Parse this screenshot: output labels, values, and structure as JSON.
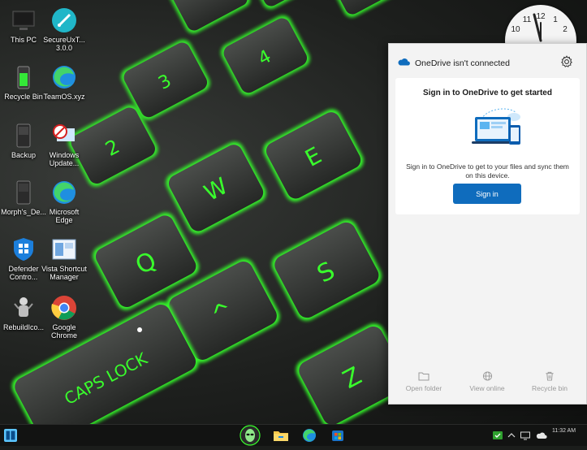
{
  "desktop": {
    "icons": [
      {
        "label": "This PC",
        "icon": "this-pc-icon"
      },
      {
        "label": "SecureUxT...\n3.0.0",
        "icon": "secureux-icon"
      },
      {
        "label": "Recycle Bin",
        "icon": "recycle-bin-icon"
      },
      {
        "label": "TeamOS.xyz",
        "icon": "edge-icon"
      },
      {
        "label": "Backup",
        "icon": "backup-icon"
      },
      {
        "label": "Windows\nUpdate...",
        "icon": "windows-update-icon"
      },
      {
        "label": "Morph's_De...",
        "icon": "morph-icon"
      },
      {
        "label": "Microsoft\nEdge",
        "icon": "edge-icon"
      },
      {
        "label": "Defender\nContro...",
        "icon": "defender-icon"
      },
      {
        "label": "Vista Shortcut\nManager",
        "icon": "vista-shortcut-icon"
      },
      {
        "label": "RebuildIco...",
        "icon": "rebuild-icon-icon"
      },
      {
        "label": "Google\nChrome",
        "icon": "chrome-icon"
      }
    ]
  },
  "clock_widget": {
    "numbers": [
      "12",
      "11",
      "1",
      "2",
      "10"
    ]
  },
  "onedrive": {
    "title": "OneDrive isn't connected",
    "settings_icon": "gear-icon",
    "card": {
      "heading": "Sign in to OneDrive to get started",
      "body": "Sign in to OneDrive to get to your files and sync them on this device.",
      "button": "Sign in"
    },
    "footer": [
      {
        "label": "Open folder",
        "icon": "folder-icon"
      },
      {
        "label": "View online",
        "icon": "globe-icon"
      },
      {
        "label": "Recycle bin",
        "icon": "trash-icon"
      }
    ]
  },
  "taskbar": {
    "start_icon": "start-icon",
    "pinned": [
      "alienware-icon",
      "file-explorer-icon",
      "edge-icon",
      "store-icon"
    ],
    "tray_time": "11:32 AM",
    "accent": "#0f6cbd"
  }
}
